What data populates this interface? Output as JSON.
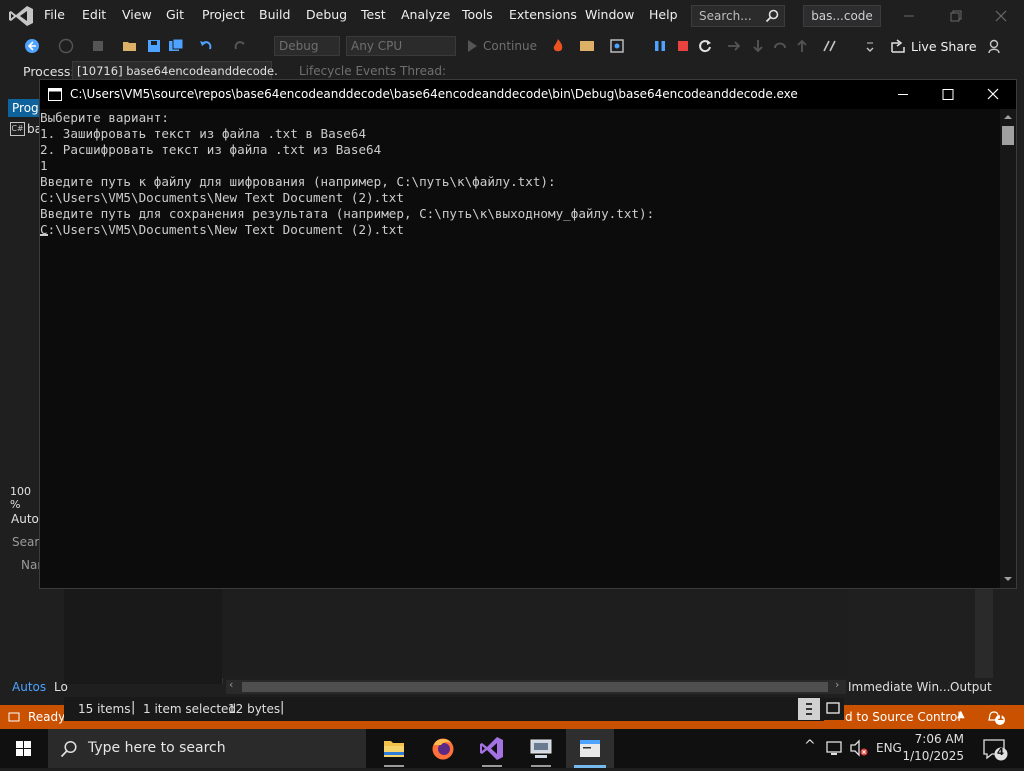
{
  "vs": {
    "menu": [
      "File",
      "Edit",
      "View",
      "Git",
      "Project",
      "Build",
      "Debug",
      "Test",
      "Analyze",
      "Tools",
      "Extensions",
      "Window",
      "Help"
    ],
    "search_placeholder": "Search...",
    "solution_name": "bas...code",
    "toolbar": {
      "config": "Debug",
      "platform": "Any CPU",
      "continue_label": "Continue",
      "live_share": "Live Share"
    },
    "process": {
      "label": "Process:",
      "value": "[10716] base64encodeanddecode.",
      "lifecycle": "Lifecycle Events",
      "thread": "Thread:"
    },
    "left_panel": {
      "tab_prog": "Progr",
      "file_tab": "ba",
      "zoom": "100 %",
      "autos_title": "Autos",
      "search": "Searc",
      "name_col": "Nar"
    },
    "bottom_tabs": {
      "autos": "Autos",
      "locals": "Lo",
      "immediate": "Immediate Win...",
      "output": "Output"
    },
    "status": {
      "ready": "Ready",
      "source_control": "d to Source Control",
      "notification_count": "1"
    },
    "accent": "#ca5100"
  },
  "explorer_status": {
    "items": "15 items",
    "selected": "1 item selected",
    "size": "12 bytes"
  },
  "console": {
    "title": "C:\\Users\\VM5\\source\\repos\\base64encodeanddecode\\base64encodeanddecode\\bin\\Debug\\base64encodeanddecode.exe",
    "lines": [
      "Выберите вариант:",
      "1. Зашифровать текст из файла .txt в Base64",
      "2. Расшифровать текст из файла .txt из Base64",
      "1",
      "Введите путь к файлу для шифрования (например, C:\\путь\\к\\файлу.txt):",
      "C:\\Users\\VM5\\Documents\\New Text Document (2).txt",
      "Введите путь для сохранения результата (например, C:\\путь\\к\\выходному_файлу.txt):",
      "C:\\Users\\VM5\\Documents\\New Text Document (2).txt"
    ]
  },
  "taskbar": {
    "search_placeholder": "Type here to search",
    "language": "ENG",
    "time": "7:06 AM",
    "date": "1/10/2025",
    "notification_count": "4"
  }
}
